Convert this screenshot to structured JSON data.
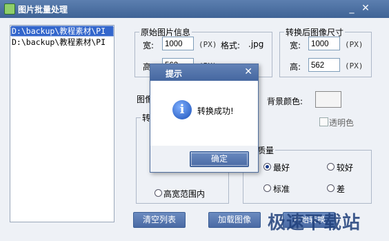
{
  "window": {
    "title": "图片批量处理",
    "minimize_glyph": "_",
    "close_glyph": "✕"
  },
  "file_list": {
    "items": [
      {
        "path": "D:\\backup\\教程素材\\PI",
        "selected": true
      },
      {
        "path": "D:\\backup\\教程素材\\PI",
        "selected": false
      }
    ]
  },
  "original_info": {
    "legend": "原始图片信息",
    "width_label": "宽:",
    "width_value": "1000",
    "width_unit": "(PX)",
    "format_label": "格式:",
    "format_value": ".jpg",
    "height_label": "高:",
    "height_value": "562",
    "height_unit": "(PX)"
  },
  "converted_size": {
    "legend": "转换后图像尺寸",
    "width_label": "宽:",
    "width_value": "1000",
    "width_unit": "(PX)",
    "height_label": "高:",
    "height_value": "562",
    "height_unit": "(PX)"
  },
  "image_label": "图像",
  "background_color_label": "背景颜色:",
  "transparent_label": "透明色",
  "convert_group": {
    "legend": "转",
    "option_label": "高宽范围内"
  },
  "quality": {
    "legend": "像质量",
    "options": [
      {
        "label": "最好",
        "checked": true
      },
      {
        "label": "较好",
        "checked": false
      },
      {
        "label": "标准",
        "checked": false
      },
      {
        "label": "差",
        "checked": false
      }
    ]
  },
  "buttons": {
    "clear_list": "清空列表",
    "load_image": "加载图像",
    "start_convert": "开始转换"
  },
  "watermark": "极速下载站",
  "dialog": {
    "title": "提示",
    "message": "转换成功!",
    "ok_label": "确定",
    "close_glyph": "✕",
    "info_glyph": "i"
  },
  "colors": {
    "titlebar": "#4a6aa4",
    "button": "#5574ad",
    "selection": "#3366cc"
  }
}
